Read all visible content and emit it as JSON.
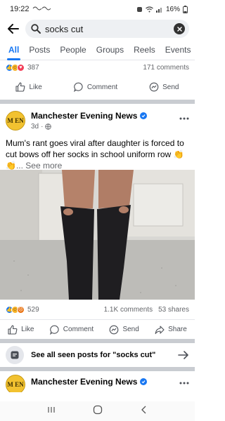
{
  "status_bar": {
    "time": "19:22",
    "battery": "16%"
  },
  "search": {
    "query": "socks cut"
  },
  "tabs": [
    {
      "label": "All",
      "active": true
    },
    {
      "label": "Posts",
      "active": false
    },
    {
      "label": "People",
      "active": false
    },
    {
      "label": "Groups",
      "active": false
    },
    {
      "label": "Reels",
      "active": false
    },
    {
      "label": "Events",
      "active": false
    }
  ],
  "prev_post": {
    "reaction_count": "387",
    "comments": "171 comments",
    "actions": {
      "like": "Like",
      "comment": "Comment",
      "send": "Send"
    }
  },
  "post": {
    "page_name": "Manchester Evening News",
    "avatar_text": "M EN",
    "time": "3d",
    "text": "Mum's rant goes viral after daughter is forced to cut bows off her socks in school uniform row 👏👏",
    "see_more": "... See more",
    "reaction_count": "529",
    "comments": "1.1K comments",
    "shares": "53 shares",
    "actions": {
      "like": "Like",
      "comment": "Comment",
      "send": "Send",
      "share": "Share"
    }
  },
  "see_all": {
    "label": "See all seen posts for \"socks cut\""
  },
  "next_post": {
    "page_name": "Manchester Evening News",
    "avatar_text": "M EN"
  },
  "colors": {
    "accent": "#1877f2",
    "divider": "#c9ccd1"
  }
}
